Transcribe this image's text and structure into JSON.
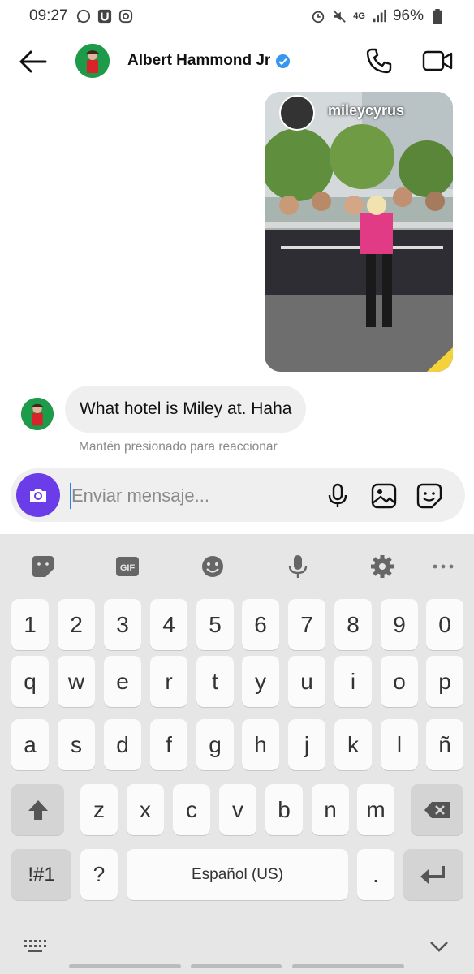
{
  "status_bar": {
    "time": "09:27",
    "battery": "96%",
    "network": "4G"
  },
  "header": {
    "contact_name": "Albert Hammond Jr",
    "verified": true
  },
  "story": {
    "username": "mileycyrus"
  },
  "messages": [
    {
      "text": "What hotel is Miley at. Haha",
      "hint": "Mantén presionado para reaccionar"
    }
  ],
  "composer": {
    "placeholder": "Enviar mensaje..."
  },
  "keyboard": {
    "row_numbers": [
      "1",
      "2",
      "3",
      "4",
      "5",
      "6",
      "7",
      "8",
      "9",
      "0"
    ],
    "row_1": [
      "q",
      "w",
      "e",
      "r",
      "t",
      "y",
      "u",
      "i",
      "o",
      "p"
    ],
    "row_2": [
      "a",
      "s",
      "d",
      "f",
      "g",
      "h",
      "j",
      "k",
      "l",
      "ñ"
    ],
    "row_3": [
      "z",
      "x",
      "c",
      "v",
      "b",
      "n",
      "m"
    ],
    "symbols_label": "!#1",
    "question": "?",
    "space_label": "Español (US)",
    "period": "."
  },
  "colors": {
    "accent": "#6b3de8",
    "verified": "#3797f0",
    "caret": "#2f7cf6"
  }
}
